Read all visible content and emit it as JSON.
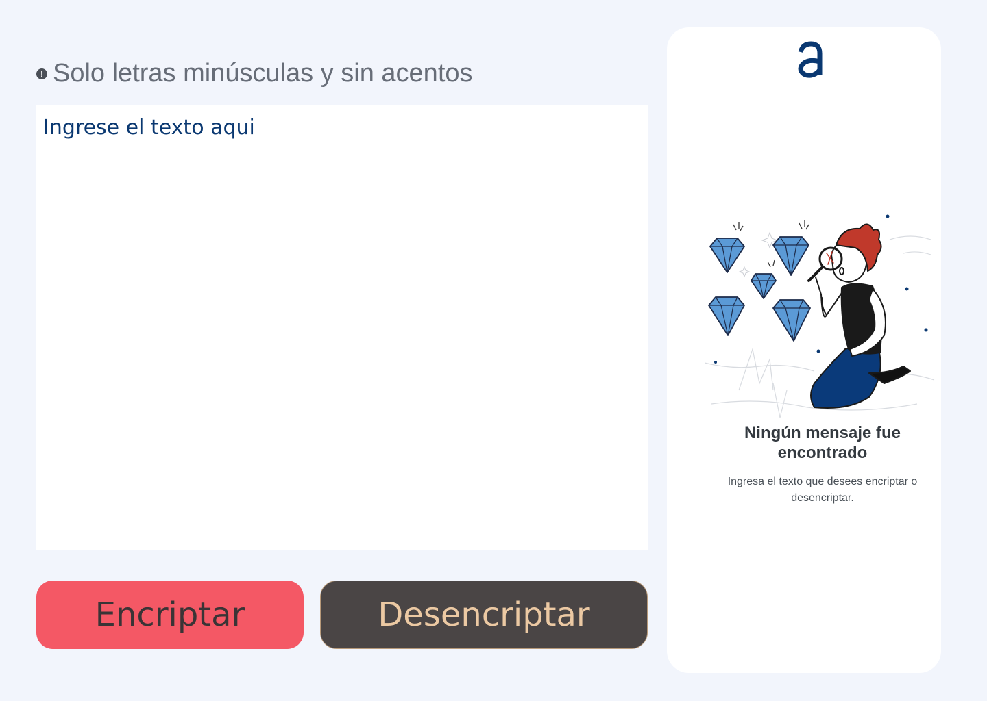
{
  "hint": {
    "icon": "exclamation-icon",
    "text": "Solo letras minúsculas y sin acentos"
  },
  "input": {
    "placeholder": "Ingrese el texto aqui",
    "value": ""
  },
  "buttons": {
    "encrypt_label": "Encriptar",
    "decrypt_label": "Desencriptar"
  },
  "output_panel": {
    "logo": "alura-logo",
    "illustration": "person-with-magnifier-diamonds",
    "title": "Ningún mensaje fue encontrado",
    "description": "Ingresa el texto que desees encriptar o desencriptar."
  },
  "colors": {
    "background": "#f2f5fc",
    "primary_blue": "#0a3871",
    "encrypt_button": "#f45865",
    "decrypt_button": "#4a4545",
    "decrypt_text": "#ecc9a3"
  }
}
